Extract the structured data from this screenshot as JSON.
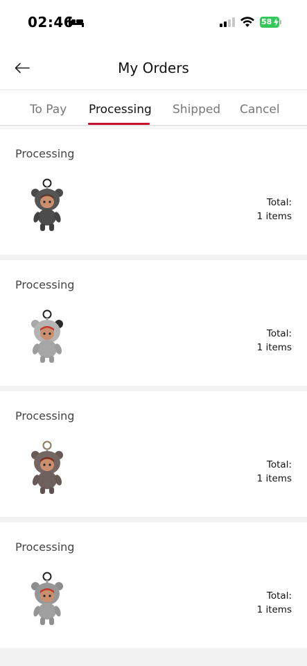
{
  "status_bar": {
    "time": "02:46",
    "battery_level": "58",
    "icons": [
      "bed-icon",
      "cellular-signal-icon",
      "wifi-icon",
      "battery-icon"
    ]
  },
  "header": {
    "title": "My Orders",
    "back_icon": "arrow-left-icon"
  },
  "tabs": [
    {
      "label": "To Pay",
      "active": false
    },
    {
      "label": "Processing",
      "active": true
    },
    {
      "label": "Shipped",
      "active": false
    },
    {
      "label": "Cancel",
      "active": false
    }
  ],
  "accent_color": "#c8102e",
  "orders": [
    {
      "status": "Processing",
      "total_label": "Total:",
      "items_count": "1 items",
      "product": "dark grey plush bear-hood doll keychain"
    },
    {
      "status": "Processing",
      "total_label": "Total:",
      "items_count": "1 items",
      "product": "light grey plush bear-hood doll keychain"
    },
    {
      "status": "Processing",
      "total_label": "Total:",
      "items_count": "1 items",
      "product": "brown-grey plush bear-hood doll keychain"
    },
    {
      "status": "Processing",
      "total_label": "Total:",
      "items_count": "1 items",
      "product": "grey plush bear-hood doll keychain"
    }
  ]
}
